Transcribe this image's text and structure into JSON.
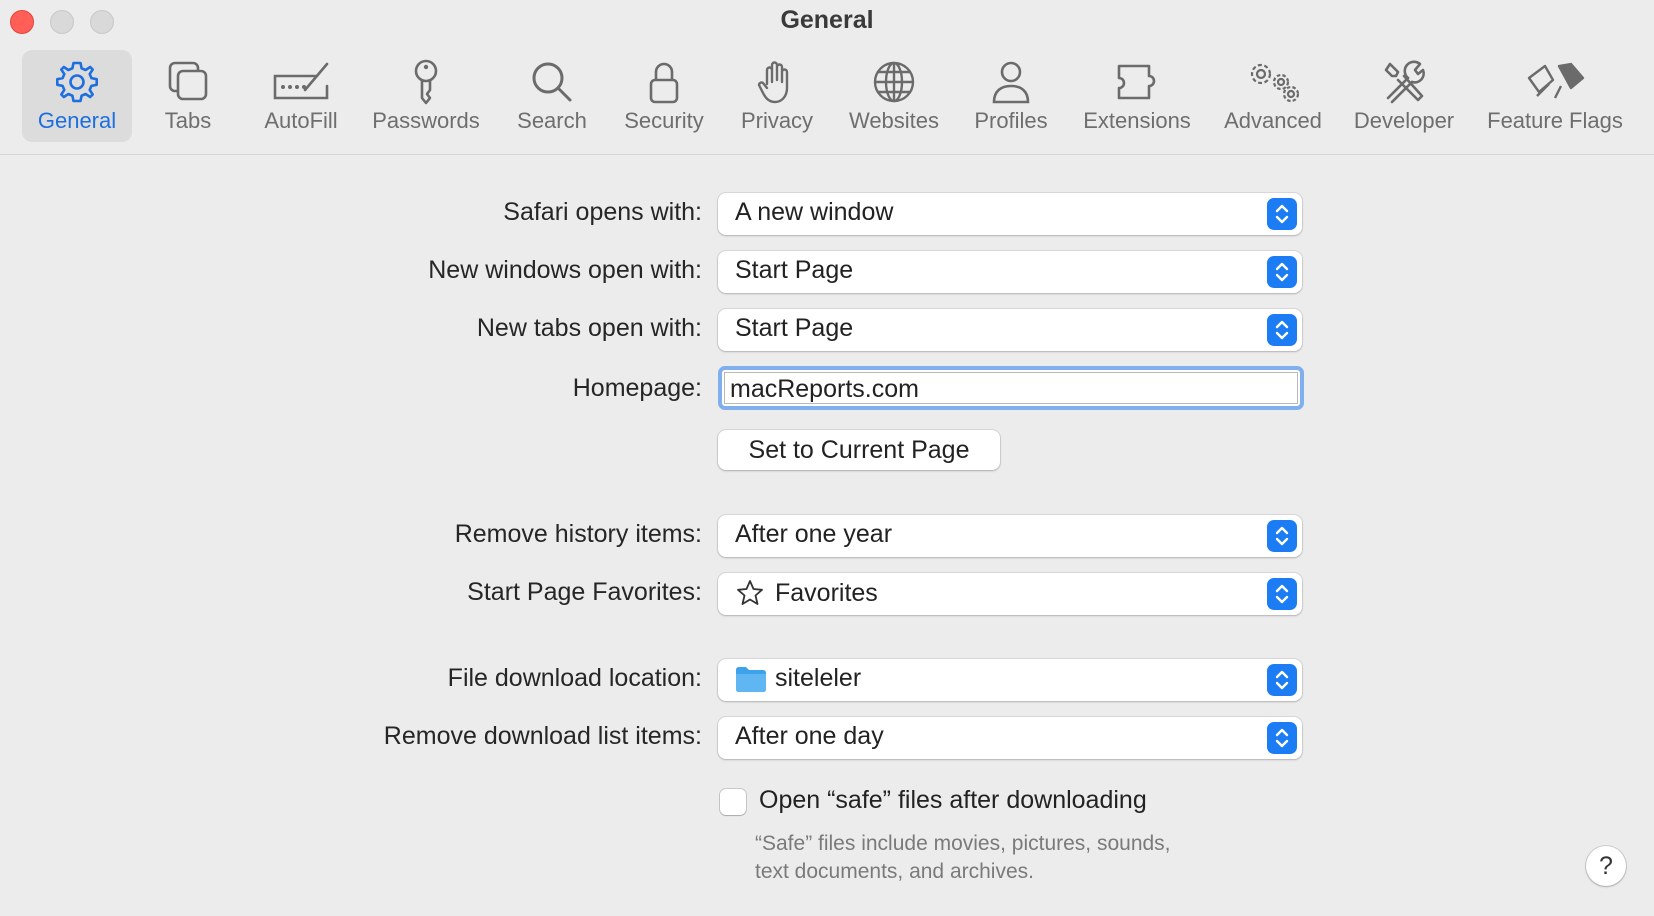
{
  "window": {
    "title": "General"
  },
  "toolbar": {
    "items": [
      {
        "label": "General",
        "icon": "gear-icon",
        "active": true
      },
      {
        "label": "Tabs",
        "icon": "tabs-icon"
      },
      {
        "label": "AutoFill",
        "icon": "autofill-icon"
      },
      {
        "label": "Passwords",
        "icon": "key-icon"
      },
      {
        "label": "Search",
        "icon": "search-icon"
      },
      {
        "label": "Security",
        "icon": "lock-icon"
      },
      {
        "label": "Privacy",
        "icon": "hand-icon"
      },
      {
        "label": "Websites",
        "icon": "globe-icon"
      },
      {
        "label": "Profiles",
        "icon": "person-icon"
      },
      {
        "label": "Extensions",
        "icon": "puzzle-icon"
      },
      {
        "label": "Advanced",
        "icon": "gears-icon"
      },
      {
        "label": "Developer",
        "icon": "tools-icon"
      },
      {
        "label": "Feature Flags",
        "icon": "flags-icon"
      }
    ],
    "accent_color": "#1d6fe0"
  },
  "form": {
    "safari_opens_with": {
      "label": "Safari opens with:",
      "value": "A new window"
    },
    "new_windows_open_with": {
      "label": "New windows open with:",
      "value": "Start Page"
    },
    "new_tabs_open_with": {
      "label": "New tabs open with:",
      "value": "Start Page"
    },
    "homepage": {
      "label": "Homepage:",
      "value": "macReports.com"
    },
    "set_current_page": {
      "label": "Set to Current Page"
    },
    "remove_history_items": {
      "label": "Remove history items:",
      "value": "After one year"
    },
    "start_page_favorites": {
      "label": "Start Page Favorites:",
      "value": "Favorites",
      "icon": "star-icon"
    },
    "file_download_location": {
      "label": "File download location:",
      "value": "siteleler",
      "icon": "folder-icon"
    },
    "remove_download_list_items": {
      "label": "Remove download list items:",
      "value": "After one day"
    },
    "open_safe_files": {
      "label": "Open “safe” files after downloading",
      "checked": false,
      "note_line1": "“Safe” files include movies, pictures, sounds,",
      "note_line2": "text documents, and archives."
    }
  },
  "help": {
    "label": "?"
  }
}
